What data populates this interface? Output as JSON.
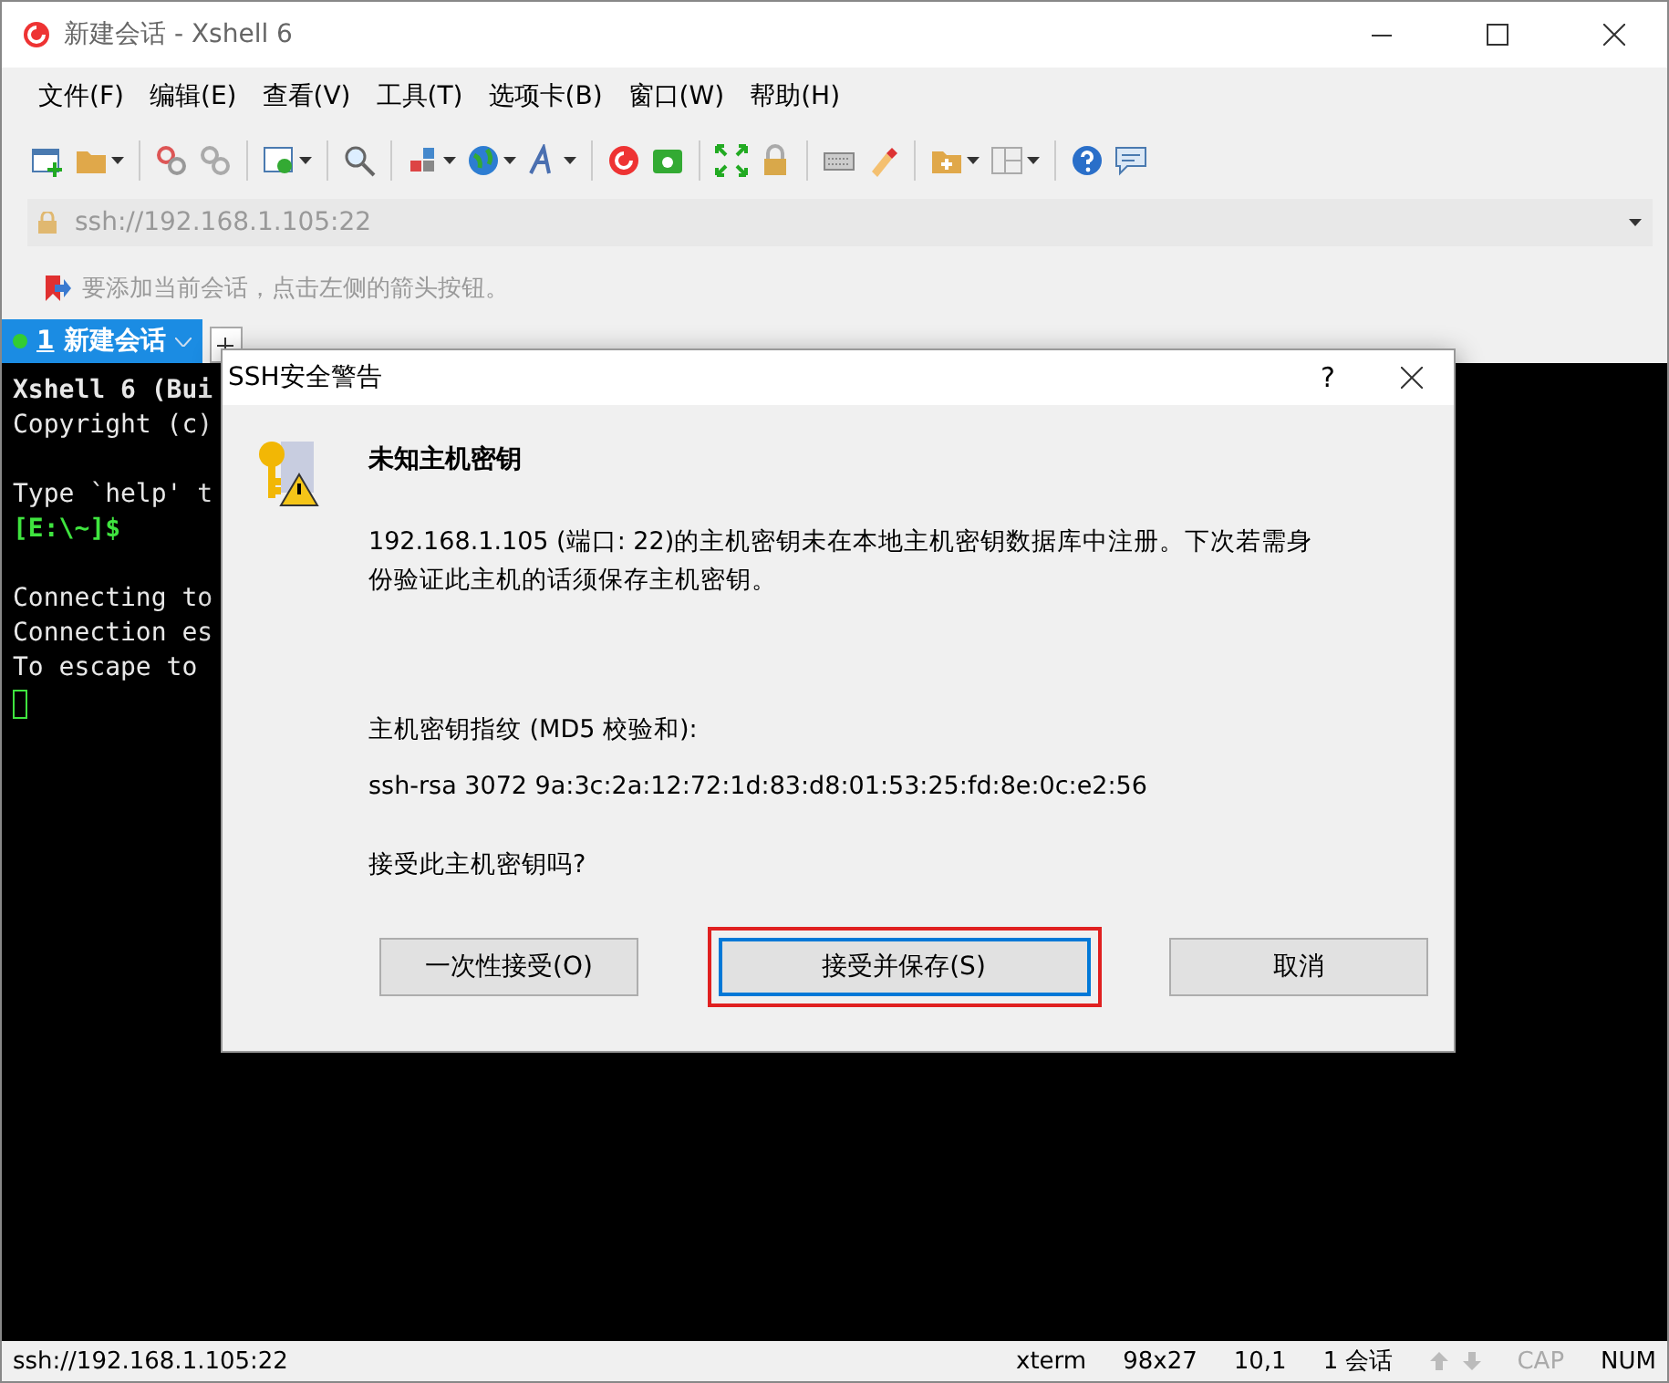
{
  "window": {
    "title": "新建会话 - Xshell 6"
  },
  "menu": [
    "文件(F)",
    "编辑(E)",
    "查看(V)",
    "工具(T)",
    "选项卡(B)",
    "窗口(W)",
    "帮助(H)"
  ],
  "address": {
    "value": "ssh://192.168.1.105:22"
  },
  "hint": "要添加当前会话，点击左侧的箭头按钮。",
  "tabs": [
    {
      "number": "1",
      "label": "新建会话",
      "selected": true,
      "connected": true
    }
  ],
  "terminal": [
    {
      "text": "Xshell 6 (Bui",
      "kind": "bold"
    },
    {
      "text": "Copyright (c)",
      "kind": "plain"
    },
    {
      "kind": "blank"
    },
    {
      "text": "Type `help' t",
      "kind": "plain"
    },
    {
      "text": "[E:\\~]$",
      "kind": "prompt"
    },
    {
      "kind": "blank"
    },
    {
      "text": "Connecting to",
      "kind": "plain"
    },
    {
      "text": "Connection es",
      "kind": "plain"
    },
    {
      "text": "To escape to",
      "kind": "plain"
    }
  ],
  "dialog": {
    "title": "SSH安全警告",
    "help": "?",
    "heading": "未知主机密钥",
    "message": "192.168.1.105 (端口: 22)的主机密钥未在本地主机密钥数据库中注册。下次若需身份验证此主机的话须保存主机密钥。",
    "fingerprint_label": "主机密钥指纹 (MD5 校验和):",
    "fingerprint": "ssh-rsa 3072 9a:3c:2a:12:72:1d:83:d8:01:53:25:fd:8e:0c:e2:56",
    "question": "接受此主机密钥吗?",
    "buttons": [
      {
        "label": "一次性接受(O)",
        "focused": false,
        "highlighted": false
      },
      {
        "label": "接受并保存(S)",
        "focused": true,
        "highlighted": true
      },
      {
        "label": "取消",
        "focused": false,
        "highlighted": false
      }
    ]
  },
  "status_bar": {
    "address": "ssh://192.168.1.105:22",
    "term": "xterm",
    "size": "98x27",
    "cursor": "10,1",
    "sessions": "1 会话",
    "cap": {
      "label": "CAP",
      "on": false
    },
    "num": {
      "label": "NUM",
      "on": true
    }
  }
}
